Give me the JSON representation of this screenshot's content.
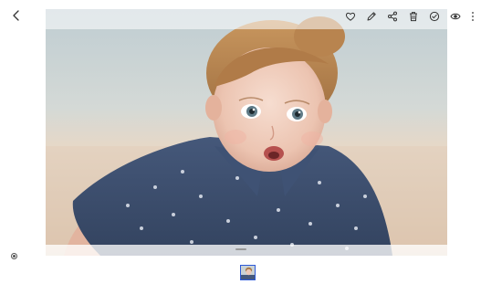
{
  "app": {
    "view": "photo-viewer"
  },
  "topbar": {
    "back_icon": "chevron-left-icon",
    "actions": [
      {
        "name": "favorite-button",
        "icon": "heart-icon"
      },
      {
        "name": "edit-button",
        "icon": "pencil-icon"
      },
      {
        "name": "share-button",
        "icon": "share-icon"
      },
      {
        "name": "delete-button",
        "icon": "trash-icon"
      },
      {
        "name": "remaster-button",
        "icon": "rotate-sparkle-icon"
      },
      {
        "name": "bixby-vision-button",
        "icon": "eye-icon"
      },
      {
        "name": "more-options-button",
        "icon": "more-vertical-icon"
      }
    ]
  },
  "details": {
    "label": "",
    "icon": "radio-icon"
  },
  "filmstrip": {
    "selected_index": 0,
    "thumbnails": 1
  },
  "colors": {
    "accent": "#2d5ad8",
    "icon": "#333333",
    "background": "#ffffff"
  }
}
